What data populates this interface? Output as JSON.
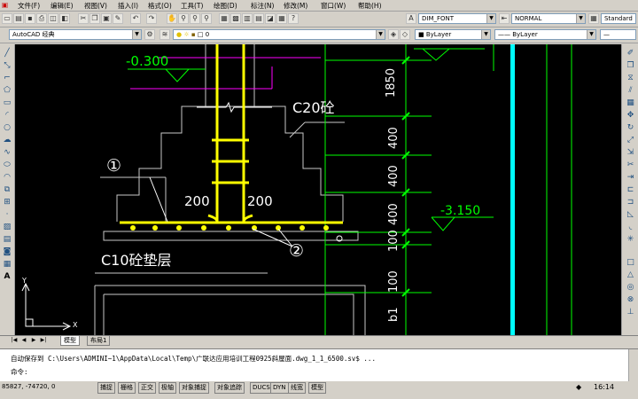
{
  "menu": [
    "文件(F)",
    "编辑(E)",
    "视图(V)",
    "插入(I)",
    "格式(O)",
    "工具(T)",
    "绘图(D)",
    "标注(N)",
    "修改(M)",
    "窗口(W)",
    "帮助(H)"
  ],
  "styles_toolbar": {
    "text_style": "DIM_FONT",
    "dim_style": "NORMAL",
    "table_style": "Standard"
  },
  "workspace": "AutoCAD 经典",
  "layer": "0",
  "properties": {
    "color": "ByLayer",
    "linetype": "ByLayer",
    "lineweight": "ByLayer"
  },
  "drawing": {
    "elev_top": "-0.300",
    "elev_right": "-3.150",
    "concrete_label": "C20砼",
    "pad_label": "C10砼垫层",
    "callout_1": "①",
    "callout_2": "②",
    "dim_left": "200",
    "dim_right": "200",
    "vert_dims": [
      "1850",
      "400",
      "400",
      "400",
      "100",
      "100",
      "b1"
    ]
  },
  "ucs": {
    "x": "X",
    "y": "Y"
  },
  "tabs": {
    "model": "模型",
    "layout": "布局1"
  },
  "command": {
    "history": "自动保存到 C:\\Users\\ADMINI~1\\AppData\\Local\\Temp\\广联达应用培训工程0925斜屋面.dwg_1_1_6500.sv$ ...",
    "prompt": "命令:"
  },
  "status": {
    "coords": "85827, -74720, 0",
    "modes": [
      "捕捉",
      "栅格",
      "正交",
      "极轴",
      "对象捕捉",
      "对象追踪",
      "DUCS",
      "DYN",
      "线宽",
      "模型"
    ],
    "clock": "16:14"
  },
  "colors": {
    "rebar": "#ffff00",
    "dims": "#00ff00",
    "cyan": "#00ffff",
    "magenta": "#ff00ff",
    "text": "#ffffff",
    "canvas": "#000000"
  }
}
